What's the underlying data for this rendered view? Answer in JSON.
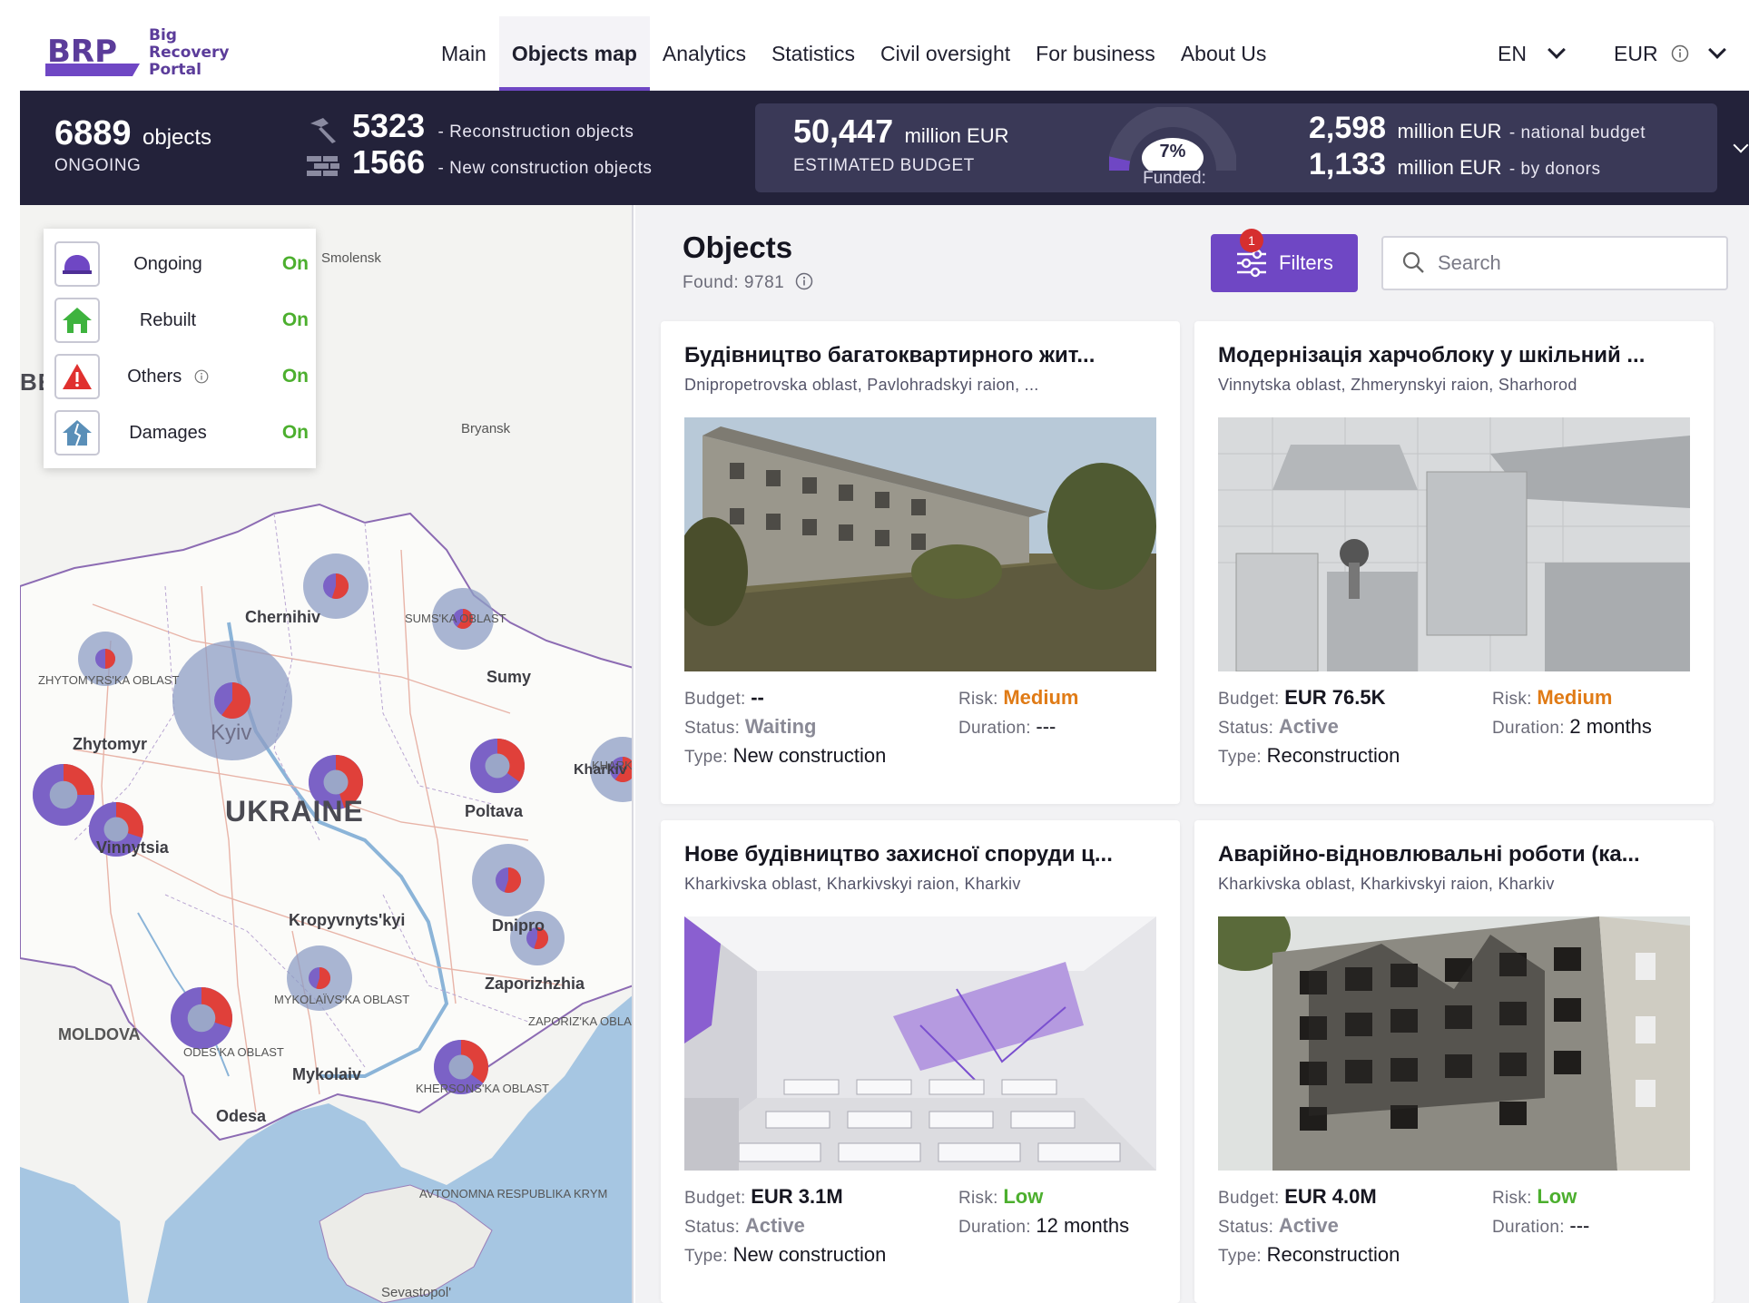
{
  "header": {
    "logo": {
      "mark": "BRP",
      "line1": "Big",
      "line2": "Recovery",
      "line3": "Portal"
    },
    "nav": [
      "Main",
      "Objects map",
      "Analytics",
      "Statistics",
      "Civil oversight",
      "For business",
      "About Us"
    ],
    "active_nav": "Objects map",
    "language": "EN",
    "currency": "EUR"
  },
  "stats": {
    "ongoing_count": "6889",
    "ongoing_unit": "objects",
    "ongoing_label": "ONGOING",
    "reconstruction_count": "5323",
    "reconstruction_label": "- Reconstruction objects",
    "new_construction_count": "1566",
    "new_construction_label": "- New construction objects",
    "estimated_budget": "50,447",
    "budget_unit": "million EUR",
    "budget_label": "ESTIMATED BUDGET",
    "funded_percent": "7%",
    "funded_label": "Funded:",
    "funded_value": 0.07,
    "national_budget": "2,598",
    "national_unit": "million EUR",
    "national_label": "- national budget",
    "donors_budget": "1,133",
    "donors_unit": "million EUR",
    "donors_label": "- by donors"
  },
  "legend": [
    {
      "label": "Ongoing",
      "state": "On",
      "icon": "hard-hat-icon"
    },
    {
      "label": "Rebuilt",
      "state": "On",
      "icon": "house-icon"
    },
    {
      "label": "Others",
      "state": "On",
      "icon": "warning-icon"
    },
    {
      "label": "Damages",
      "state": "On",
      "icon": "damaged-house-icon"
    }
  ],
  "map": {
    "country": "UKRAINE",
    "cities": [
      "Chernihiv",
      "Sumy",
      "Zhytomyr",
      "Kyiv",
      "Poltava",
      "Vinnytsia",
      "Kropyvnyts'kyi",
      "Dnipro",
      "Zaporizhzhia",
      "Mykolaiv",
      "Odesa",
      "MOLDOVA",
      "Bryansk",
      "Sevastopol'",
      "Smolensk",
      "BE",
      "Kharkiv"
    ],
    "regions": [
      "ZHYTOMYRS'KA OBLAST",
      "SUMS'KA OBLAST",
      "MYKOLAÏVS'KA OBLAST",
      "ODES'KA OBLAST",
      "KHERSONS'KA OBLAST",
      "ZAPORIZ'KA OBLAST",
      "AVTONOMNA RESPUBLIKA KRYM",
      "KHARK OBL"
    ]
  },
  "objects": {
    "title": "Objects",
    "found": "Found: 9781",
    "filters_label": "Filters",
    "filters_count": "1",
    "search_placeholder": "Search"
  },
  "cards": [
    {
      "title": "Будівництво багатоквартирного жит...",
      "location": "Dnipropetrovska oblast, Pavlohradskyi raion, ...",
      "budget_label": "Budget:",
      "budget": "--",
      "risk_label": "Risk:",
      "risk": "Medium",
      "status_label": "Status:",
      "status": "Waiting",
      "duration_label": "Duration:",
      "duration": "---",
      "type_label": "Type:",
      "type": "New construction"
    },
    {
      "title": "Модернізація харчоблоку у шкільний ...",
      "location": "Vinnytska oblast, Zhmerynskyi raion, Sharhorod",
      "budget_label": "Budget:",
      "budget": "EUR 76.5K",
      "risk_label": "Risk:",
      "risk": "Medium",
      "status_label": "Status:",
      "status": "Active",
      "duration_label": "Duration:",
      "duration": "2 months",
      "type_label": "Type:",
      "type": "Reconstruction"
    },
    {
      "title": "Нове будівництво захисної споруди ц...",
      "location": "Kharkivska oblast, Kharkivskyi raion, Kharkiv",
      "budget_label": "Budget:",
      "budget": "EUR 3.1M",
      "risk_label": "Risk:",
      "risk": "Low",
      "status_label": "Status:",
      "status": "Active",
      "duration_label": "Duration:",
      "duration": "12 months",
      "type_label": "Type:",
      "type": "New construction"
    },
    {
      "title": "Аварійно-відновлювальні роботи (ка...",
      "location": "Kharkivska oblast, Kharkivskyi raion, Kharkiv",
      "budget_label": "Budget:",
      "budget": "EUR 4.0M",
      "risk_label": "Risk:",
      "risk": "Low",
      "status_label": "Status:",
      "status": "Active",
      "duration_label": "Duration:",
      "duration": "---",
      "type_label": "Type:",
      "type": "Reconstruction"
    }
  ],
  "colors": {
    "accent": "#6f47c4",
    "stats_bg": "#23223a",
    "on_green": "#4caf2e",
    "risk_medium": "#e07b16",
    "risk_low": "#4caf2e"
  }
}
